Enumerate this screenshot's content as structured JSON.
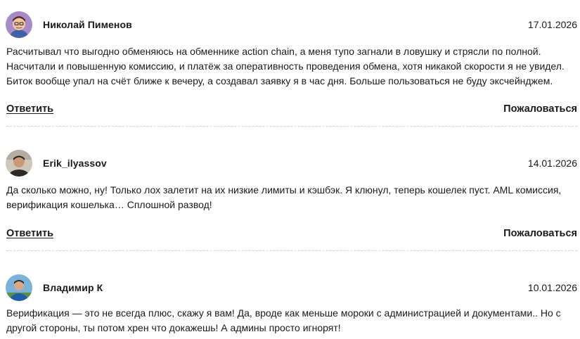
{
  "comments": [
    {
      "author": "Николай Пименов",
      "date": "17.01.2026",
      "text": "Расчитывал что выгодно обменяюсь на обменнике action chain, а меня тупо загнали в ловушку и стрясли по полной. Насчитали и повышенную комиссию, и платёж за оперативность проведения обмена, хотя никакой скорости я не увидел. Биток вообще упал на счёт ближе к вечеру, а создавал заявку я в час дня. Больше пользоваться не буду эксчейнджем.",
      "reply_label": "Ответить",
      "report_label": "Пожаловаться",
      "avatar_icon": "avatar-cartoon-icon"
    },
    {
      "author": "Erik_ilyassov",
      "date": "14.01.2026",
      "text": "Да сколько можно, ну! Только лох залетит на их низкие лимиты и кэшбэк. Я клюнул, теперь кошелек пуст. AML комиссия, верификация кошелька… Сплошной развод!",
      "reply_label": "Ответить",
      "report_label": "Пожаловаться",
      "avatar_icon": "avatar-photo-icon"
    },
    {
      "author": "Владимир К",
      "date": "10.01.2026",
      "text": "Верификация — это не всегда плюс, скажу я вам! Да, вроде как меньше мороки с администрацией и документами.. Но с другой стороны, ты потом хрен что докажешь! А админы просто игнорят!",
      "avatar_icon": "avatar-photo-icon"
    }
  ]
}
